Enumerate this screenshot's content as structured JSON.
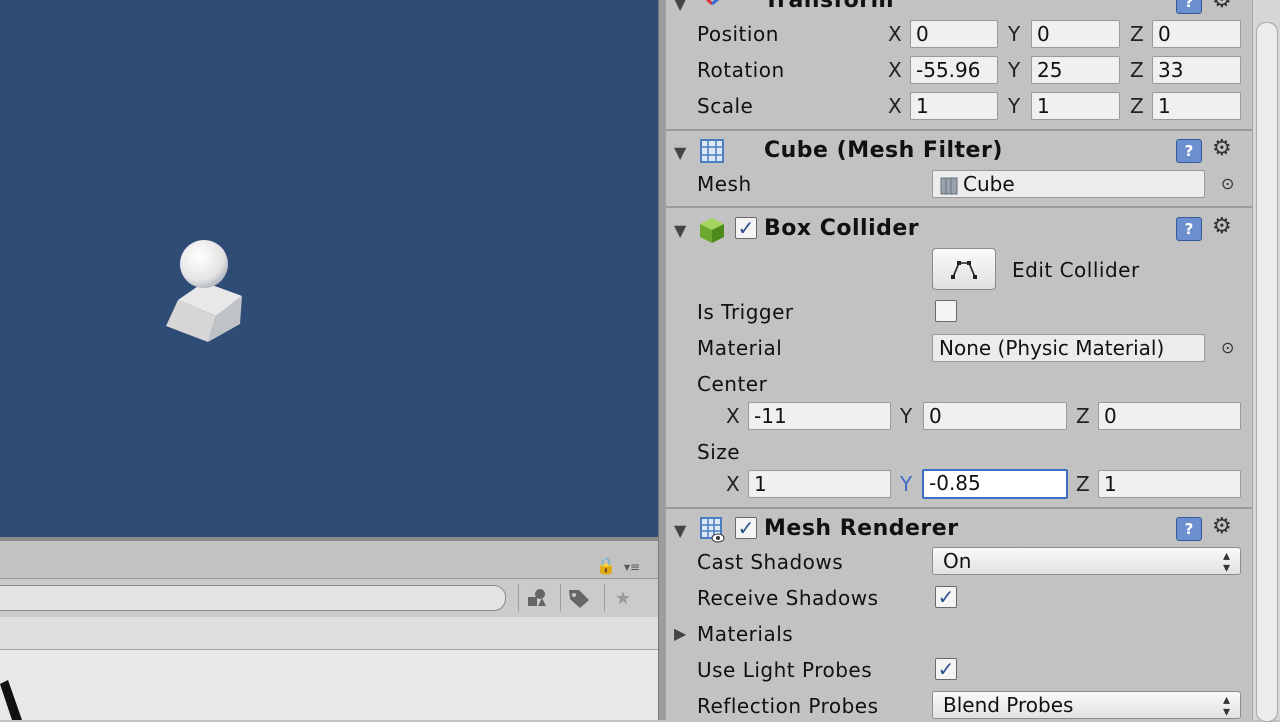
{
  "colors": {
    "scene_background": "#2f4c76",
    "inspector_background": "#c2c2c2",
    "focus_blue": "#3d6ec7"
  },
  "transform": {
    "title": "Transform",
    "position": {
      "label": "Position",
      "x": "0",
      "y": "0",
      "z": "0"
    },
    "rotation": {
      "label": "Rotation",
      "x": "-55.96",
      "y": "25",
      "z": "33"
    },
    "scale": {
      "label": "Scale",
      "x": "1",
      "y": "1",
      "z": "1"
    }
  },
  "axes": {
    "x": "X",
    "y": "Y",
    "z": "Z"
  },
  "mesh_filter": {
    "title": "Cube (Mesh Filter)",
    "mesh_label": "Mesh",
    "mesh_value": "Cube",
    "icon": "grid-mesh-icon"
  },
  "box_collider": {
    "title": "Box Collider",
    "enabled": true,
    "edit_collider_label": "Edit Collider",
    "is_trigger_label": "Is Trigger",
    "is_trigger": false,
    "material_label": "Material",
    "material_value": "None (Physic Material)",
    "center_label": "Center",
    "center": {
      "x": "-11",
      "y": "0",
      "z": "0"
    },
    "size_label": "Size",
    "size": {
      "x": "1",
      "y": "-0.85",
      "z": "1"
    }
  },
  "mesh_renderer": {
    "title": "Mesh Renderer",
    "enabled": true,
    "cast_shadows_label": "Cast Shadows",
    "cast_shadows_value": "On",
    "receive_shadows_label": "Receive Shadows",
    "receive_shadows": true,
    "materials_label": "Materials",
    "use_light_probes_label": "Use Light Probes",
    "use_light_probes": true,
    "reflection_probes_label": "Reflection Probes",
    "reflection_probes_value": "Blend Probes"
  },
  "glyphs": {
    "foldout_open": "▼",
    "foldout_closed": "▶",
    "help": "?",
    "gear": "⚙",
    "check": "✓",
    "target": "⊙",
    "dropdown": "⬍",
    "lock": "🔒",
    "menu": "≡",
    "tag": "🏷",
    "star": "★"
  }
}
